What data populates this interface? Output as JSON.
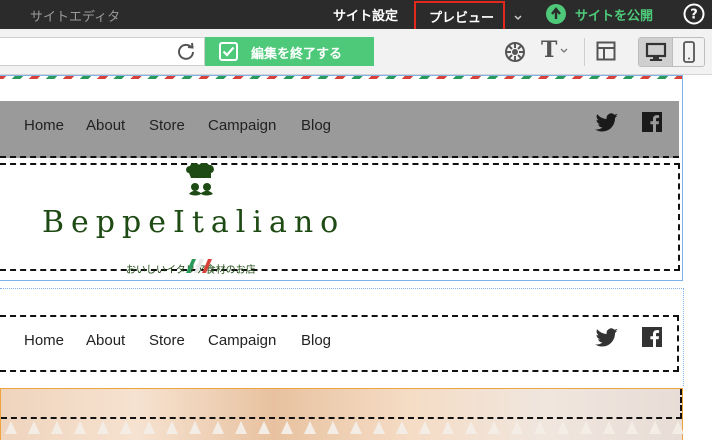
{
  "topbar": {
    "app_title": "サイトエディタ",
    "site_settings": "サイト設定",
    "preview": "プレビュー",
    "publish": "サイトを公開",
    "help": "?"
  },
  "toolbar": {
    "finish_edit": "編集を終了する",
    "font_menu_label": "T",
    "colors": {
      "accent": "#4ec97a",
      "highlight": "#e0291c"
    }
  },
  "site": {
    "nav": [
      "Home",
      "About",
      "Store",
      "Campaign",
      "Blog"
    ],
    "logo_text": "BeppeItaliano",
    "tagline": "おいしいイタリア食材のお店"
  }
}
